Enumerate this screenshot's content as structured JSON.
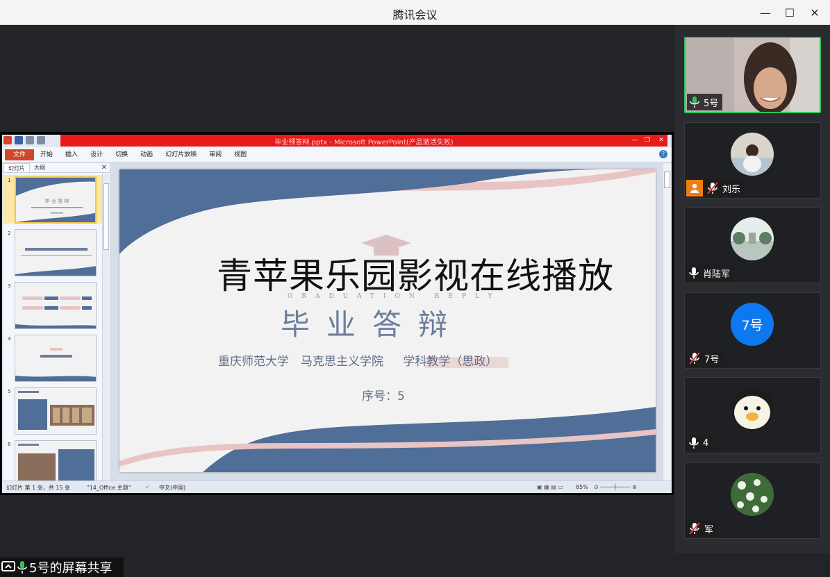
{
  "app": {
    "title": "腾讯会议"
  },
  "window_controls": {
    "minimize": "—",
    "maximize": "☐",
    "close": "✕"
  },
  "ppt": {
    "window_title": "毕业预答辩.pptx - Microsoft PowerPoint(产品激活失败)",
    "tabs": [
      "文件",
      "开始",
      "插入",
      "设计",
      "切换",
      "动画",
      "幻灯片放映",
      "审阅",
      "视图"
    ],
    "pane_tabs": [
      "幻灯片",
      "大纲"
    ],
    "thumb_numbers": [
      "1",
      "2",
      "3",
      "4",
      "5",
      "6"
    ],
    "slide": {
      "main_title": "青苹果乐园影视在线播放",
      "subtitle_en": "GRADUATION REPLY",
      "heading": "毕业答辩",
      "school_line": "重庆师范大学　马克思主义学院　 学科教学（思政）",
      "serial": "序号：5"
    },
    "status": {
      "slide_count": "幻灯片 第 1 张，共 15 张",
      "theme": "\"14_Office 主题\"",
      "language": "中文(中国)",
      "zoom": "85%"
    }
  },
  "share_label": "5号的屏幕共享",
  "participants": [
    {
      "name": "5号",
      "mic": "on",
      "active": true
    },
    {
      "name": "刘乐",
      "mic": "muted",
      "badge": "person"
    },
    {
      "name": "肖陆军",
      "mic": "on"
    },
    {
      "name": "7号",
      "mic": "muted",
      "avatar_text": "7号"
    },
    {
      "name": "4",
      "mic": "on"
    },
    {
      "name": "军",
      "mic": "muted"
    }
  ],
  "colors": {
    "accent_green": "#2ec45b",
    "avatar_blue": "#0e78f0",
    "slide_blue": "#4f6e98",
    "slide_pink": "#e8c4c4"
  }
}
